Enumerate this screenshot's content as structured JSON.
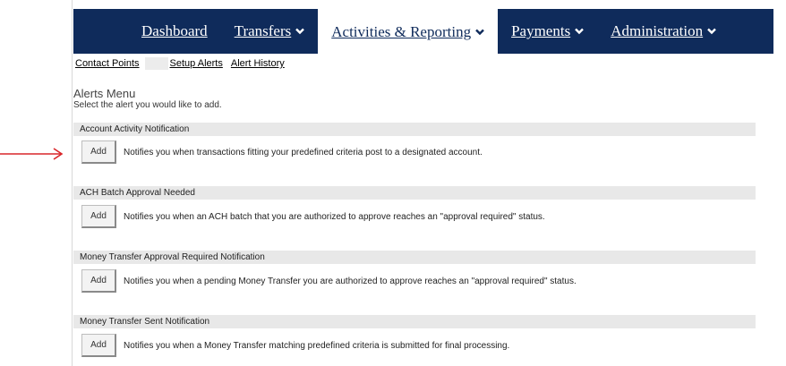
{
  "nav": {
    "dashboard": "Dashboard",
    "transfers": "Transfers",
    "activities": "Activities & Reporting",
    "payments": "Payments",
    "administration": "Administration"
  },
  "subnav": {
    "contact_points": "Contact Points",
    "setup_alerts": "Setup Alerts",
    "alert_history": "Alert History"
  },
  "alerts_menu": {
    "title": "Alerts Menu",
    "subtitle": "Select the alert you would like to add."
  },
  "alerts": [
    {
      "name": "Account Activity Notification",
      "button": "Add",
      "description": "Notifies you when transactions fitting your predefined criteria post to a designated account."
    },
    {
      "name": "ACH Batch Approval Needed",
      "button": "Add",
      "description": "Notifies you when an ACH batch that you are authorized to approve reaches an \"approval required\" status."
    },
    {
      "name": "Money Transfer Approval Required Notification",
      "button": "Add",
      "description": "Notifies you when a pending Money Transfer you are authorized to approve reaches an \"approval required\" status."
    },
    {
      "name": "Money Transfer Sent Notification",
      "button": "Add",
      "description": "Notifies you when a Money Transfer matching predefined criteria is submitted for final processing."
    }
  ],
  "colors": {
    "nav_bg": "#0f2b5b",
    "section_bg": "#e8e8e8",
    "arrow": "#d9262a"
  },
  "icons": {
    "nav_dropdown": "chevron-down-icon",
    "pointer": "arrow-right-icon"
  }
}
